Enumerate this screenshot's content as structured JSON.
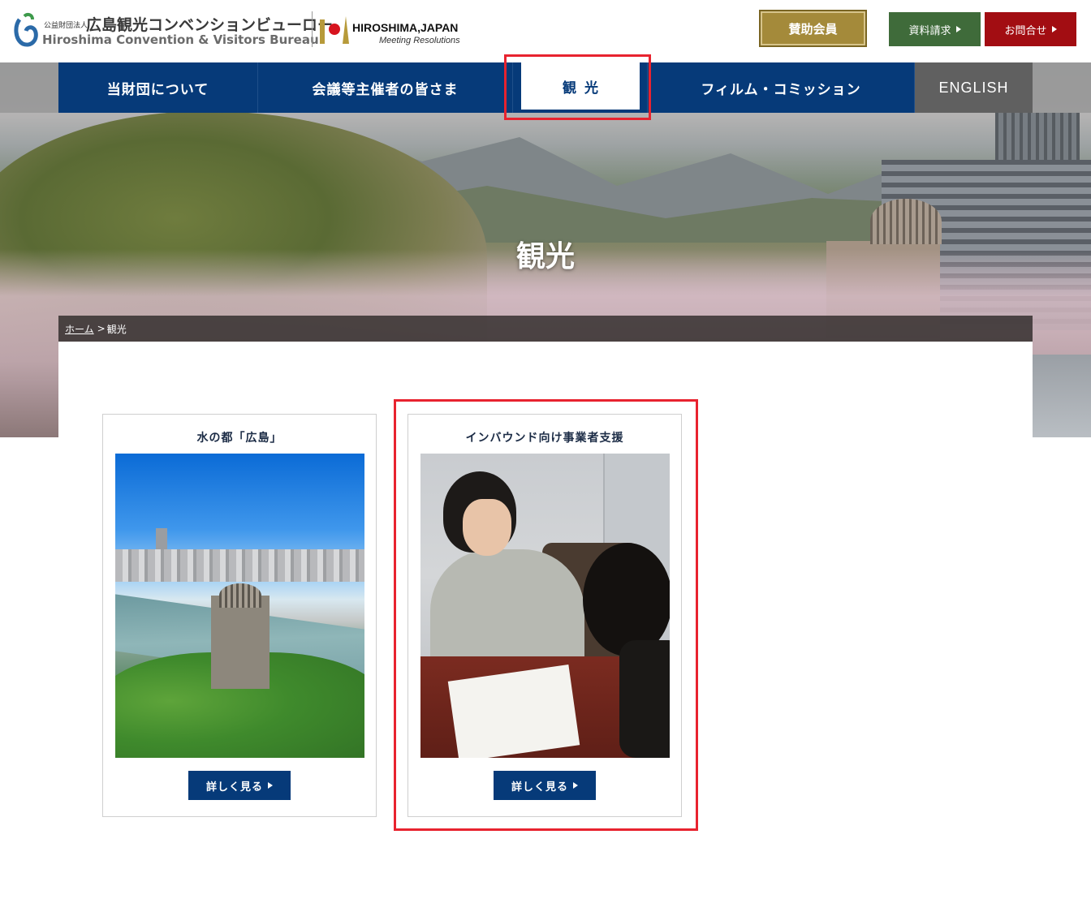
{
  "header": {
    "org_small": "公益財団法人",
    "org_name_jp": "広島観光コンベンションビューロー",
    "org_name_en": "Hiroshima Convention & Visitors Bureau",
    "partner_title": "HIROSHIMA,JAPAN",
    "partner_sub": "Meeting Resolutions",
    "sponsor_label": "賛助会員",
    "docs_label": "資料請求",
    "contact_label": "お問合せ"
  },
  "nav": {
    "items": [
      {
        "label": "当財団について"
      },
      {
        "label": "会議等主催者の皆さま"
      },
      {
        "label": "観光",
        "active": true
      },
      {
        "label": "フィルム・コミッション"
      },
      {
        "label": "ENGLISH"
      }
    ]
  },
  "hero": {
    "title": "観光"
  },
  "breadcrumb": {
    "home": "ホーム",
    "separator": ">",
    "current": "観光"
  },
  "cards": [
    {
      "title": "水の都「広島」",
      "button": "詳しく見る"
    },
    {
      "title": "インバウンド向け事業者支援",
      "button": "詳しく見る"
    }
  ],
  "colors": {
    "nav_blue": "#063a79",
    "sponsor_gold": "#a48a3a",
    "docs_green": "#3f6b3a",
    "contact_red": "#a20d12",
    "highlight_red": "#e8232f"
  }
}
